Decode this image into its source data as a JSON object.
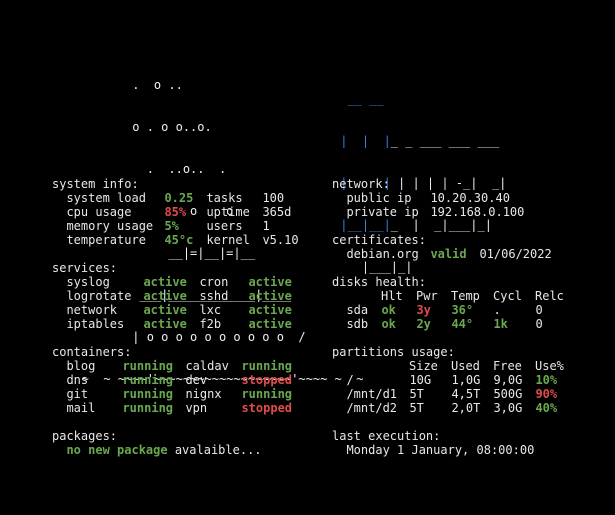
{
  "ascii": {
    "ship": [
      "          .  o ..",
      "          o . o o..o.",
      "            .  ..o..  .",
      "                  o    o",
      "               __|=|__|=|__",
      "           ___|____________|____",
      "          | o o o o o o o o o o  /",
      "   ~  ~ ~~~~'~~~~~~~~~~~~~~~~~~~'~~~~ ~  ~"
    ],
    "logo": [
      [
        "  __ __",
        "",
        ""
      ],
      [
        " |  |  |",
        "_ _ ___ ___ ___",
        ""
      ],
      [
        " |     |",
        " | | | | -_|  _|",
        ""
      ],
      [
        " |__|__|",
        "_  |  _|___|_|",
        ""
      ],
      [
        "",
        "    |___|_|",
        ""
      ]
    ]
  },
  "system_info": {
    "heading": "system info:",
    "rows": [
      {
        "label": "system load",
        "value": "0.25",
        "value_color": "green",
        "label2": "tasks",
        "value2": "100"
      },
      {
        "label": "cpu usage",
        "value": "85%",
        "value_color": "red",
        "label2": "uptime",
        "value2": "365d"
      },
      {
        "label": "memory usage",
        "value": "5%",
        "value_color": "green",
        "label2": "users",
        "value2": "1"
      },
      {
        "label": "temperature",
        "value": "45°c",
        "value_color": "green",
        "label2": "kernel",
        "value2": "v5.10"
      }
    ]
  },
  "network": {
    "heading": "network:",
    "rows": [
      {
        "label": "public ip",
        "value": "10.20.30.40"
      },
      {
        "label": "private ip",
        "value": "192.168.0.100"
      }
    ]
  },
  "services": {
    "heading": "services:",
    "rows": [
      {
        "name1": "syslog",
        "status1": "active",
        "color1": "green",
        "name2": "cron",
        "status2": "active",
        "color2": "green"
      },
      {
        "name1": "logrotate",
        "status1": "active",
        "color1": "green",
        "name2": "sshd",
        "status2": "active",
        "color2": "green"
      },
      {
        "name1": "network",
        "status1": "active",
        "color1": "green",
        "name2": "lxc",
        "status2": "active",
        "color2": "green"
      },
      {
        "name1": "iptables",
        "status1": "active",
        "color1": "green",
        "name2": "f2b",
        "status2": "active",
        "color2": "green"
      }
    ]
  },
  "certificates": {
    "heading": "certificates:",
    "rows": [
      {
        "domain": "debian.org",
        "status": "valid",
        "color": "green",
        "date": "01/06/2022"
      }
    ]
  },
  "disks": {
    "heading": "disks health:",
    "columns": [
      "Hlt",
      "Pwr",
      "Temp",
      "Cycl",
      "Relc"
    ],
    "rows": [
      {
        "name": "sda",
        "hlt": "ok",
        "hlt_color": "green",
        "pwr": "3y",
        "pwr_color": "red",
        "temp": "36°",
        "temp_color": "green",
        "cycl": ".",
        "cycl_color": "white",
        "relc": "0"
      },
      {
        "name": "sdb",
        "hlt": "ok",
        "hlt_color": "green",
        "pwr": "2y",
        "pwr_color": "green",
        "temp": "44°",
        "temp_color": "green",
        "cycl": "1k",
        "cycl_color": "green",
        "relc": "0"
      }
    ]
  },
  "containers": {
    "heading": "containers:",
    "rows": [
      {
        "name1": "blog",
        "status1": "running",
        "color1": "green",
        "name2": "caldav",
        "status2": "running",
        "color2": "green"
      },
      {
        "name1": "dns",
        "status1": "running",
        "color1": "green",
        "name2": "dev",
        "status2": "stopped",
        "color2": "red"
      },
      {
        "name1": "git",
        "status1": "running",
        "color1": "green",
        "name2": "nignx",
        "status2": "running",
        "color2": "green"
      },
      {
        "name1": "mail",
        "status1": "running",
        "color1": "green",
        "name2": "vpn",
        "status2": "stopped",
        "color2": "red"
      }
    ]
  },
  "partitions": {
    "heading": "partitions usage:",
    "columns": [
      "Size",
      "Used",
      "Free",
      "Use%"
    ],
    "rows": [
      {
        "mount": "/",
        "size": "10G",
        "used": "1,0G",
        "free": "9,0G",
        "use": "10%",
        "use_color": "green"
      },
      {
        "mount": "/mnt/d1",
        "size": "5T",
        "used": "4,5T",
        "free": "500G",
        "use": "90%",
        "use_color": "red"
      },
      {
        "mount": "/mnt/d2",
        "size": "5T",
        "used": "2,0T",
        "free": "3,0G",
        "use": "40%",
        "use_color": "green"
      }
    ]
  },
  "packages": {
    "heading": "packages:",
    "highlight": "no new package",
    "rest": " avalaible..."
  },
  "last_execution": {
    "heading": "last execution:",
    "value": "Monday 1 January, 08:00:00"
  },
  "colors": {
    "background": "#000000",
    "text": "#e8e8e8",
    "green": "#6aa84f",
    "red": "#e04b4b",
    "blue": "#3d7be0"
  }
}
